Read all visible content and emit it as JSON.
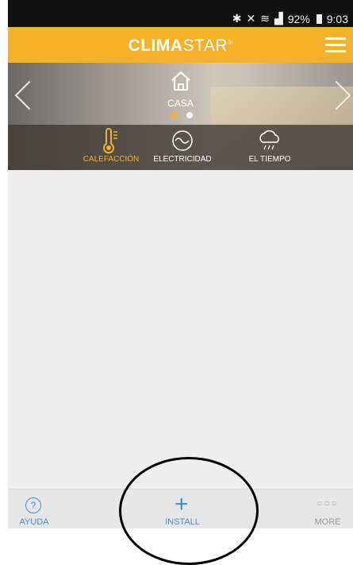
{
  "status_bar": {
    "battery_text": "92%",
    "time": "9:03"
  },
  "header": {
    "brand_bold": "CLIMA",
    "brand_thin": "STAR",
    "brand_mark": "®"
  },
  "hero": {
    "location": "CASA"
  },
  "tabs": [
    {
      "label": "CALEFACCIÓN",
      "icon": "thermometer-icon",
      "active": true
    },
    {
      "label": "ELECTRICIDAD",
      "icon": "electricity-icon",
      "active": false
    },
    {
      "label": "EL TIEMPO",
      "icon": "weather-icon",
      "active": false
    }
  ],
  "bottom_bar": {
    "help_label": "AYUDA",
    "install_label": "INSTALL",
    "more_label": "MORE"
  },
  "colors": {
    "accent": "#f5b12a",
    "link": "#3f8fd5"
  }
}
